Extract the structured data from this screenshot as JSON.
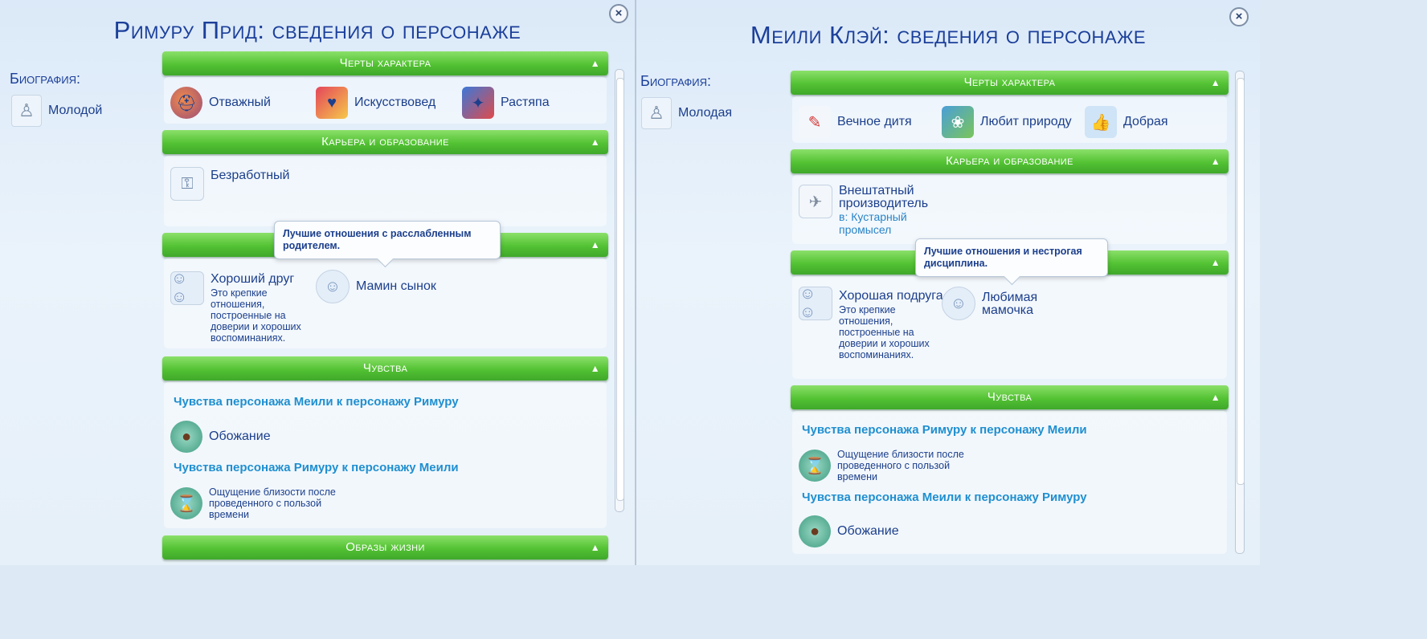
{
  "left": {
    "title": "Римуру Прид: сведения о персонаже",
    "bio_label": "Биография:",
    "age": "Молодой",
    "traits_header": "Черты характера",
    "traits": [
      "Отважный",
      "Искусствовед",
      "Растяпа"
    ],
    "career_header": "Карьера и образование",
    "career": "Безработный",
    "relationship": {
      "name": "Хороший друг",
      "desc": "Это крепкие отношения, построенные на доверии и хороших воспоминаниях.",
      "second": "Мамин сынок"
    },
    "tooltip": "Лучшие отношения с расслабленным родителем.",
    "feelings_header": "Чувства",
    "feelings": [
      {
        "title": "Чувства персонажа Меили к персонажу Римуру",
        "value": "Обожание"
      },
      {
        "title": "Чувства персонажа Римуру к персонажу Меили",
        "value": "Ощущение близости после проведенного с пользой времени"
      }
    ],
    "lifestyles_header": "Образы жизни"
  },
  "right": {
    "title": "Меили Клэй: сведения о персонаже",
    "bio_label": "Биография:",
    "age": "Молодая",
    "traits_header": "Черты характера",
    "traits": [
      "Вечное дитя",
      "Любит природу",
      "Добрая"
    ],
    "career_header": "Карьера и образование",
    "career": "Внештатный производитель",
    "career_sub": "в: Кустарный промысел",
    "relationship": {
      "name": "Хорошая подруга",
      "desc": "Это крепкие отношения, построенные на доверии и хороших воспоминаниях.",
      "second": "Любимая мамочка"
    },
    "tooltip": "Лучшие отношения и нестрогая дисциплина.",
    "feelings_header": "Чувства",
    "feelings": [
      {
        "title": "Чувства персонажа Римуру к персонажу Меили",
        "value": "Ощущение близости после проведенного с пользой времени"
      },
      {
        "title": "Чувства персонажа Меили к персонажу Римуру",
        "value": "Обожание"
      }
    ]
  },
  "icons": {
    "close": "×",
    "chevron": "▲"
  },
  "colors": {
    "header_green": "#53c233",
    "title_blue": "#1b3f9a",
    "feeling_title_blue": "#1f8fd0"
  }
}
